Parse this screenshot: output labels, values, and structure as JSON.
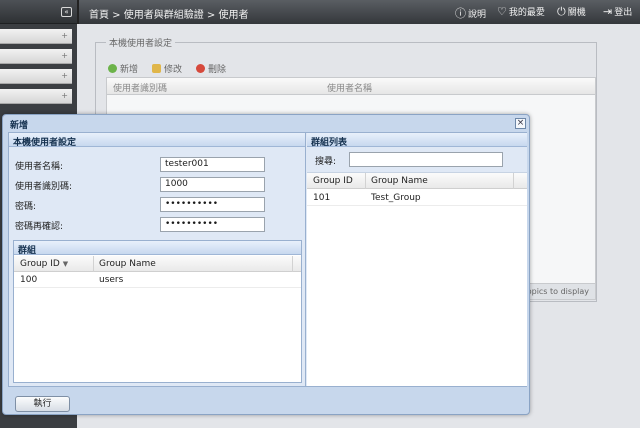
{
  "topbar": {
    "breadcrumb": "首頁 > 使用者與群組驗證 > 使用者",
    "help": "說明",
    "favorites": "我的最愛",
    "shutdown": "關機",
    "logout": "登出"
  },
  "background": {
    "legend": "本機使用者設定",
    "add": "新增",
    "edit": "修改",
    "delete": "刪除",
    "col_user_id": "使用者識別碼",
    "col_user_name": "使用者名稱",
    "empty_text": "o topics to display"
  },
  "modal": {
    "title": "新增",
    "local_settings_header": "本機使用者設定",
    "form": {
      "username_label": "使用者名稱:",
      "username_value": "tester001",
      "uid_label": "使用者識別碼:",
      "uid_value": "1000",
      "password_label": "密碼:",
      "password_value": "••••••••••",
      "confirm_label": "密碼再確認:",
      "confirm_value": "••••••••••"
    },
    "groups_header": "群組",
    "groups_table": {
      "columns": [
        "Group ID",
        "Group Name"
      ],
      "rows": [
        [
          "100",
          "users"
        ]
      ]
    },
    "group_list_header": "群組列表",
    "search_label": "搜尋:",
    "group_list_table": {
      "columns": [
        "Group ID",
        "Group Name"
      ],
      "rows": [
        [
          "101",
          "Test_Group"
        ]
      ]
    },
    "execute_button": "執行"
  }
}
